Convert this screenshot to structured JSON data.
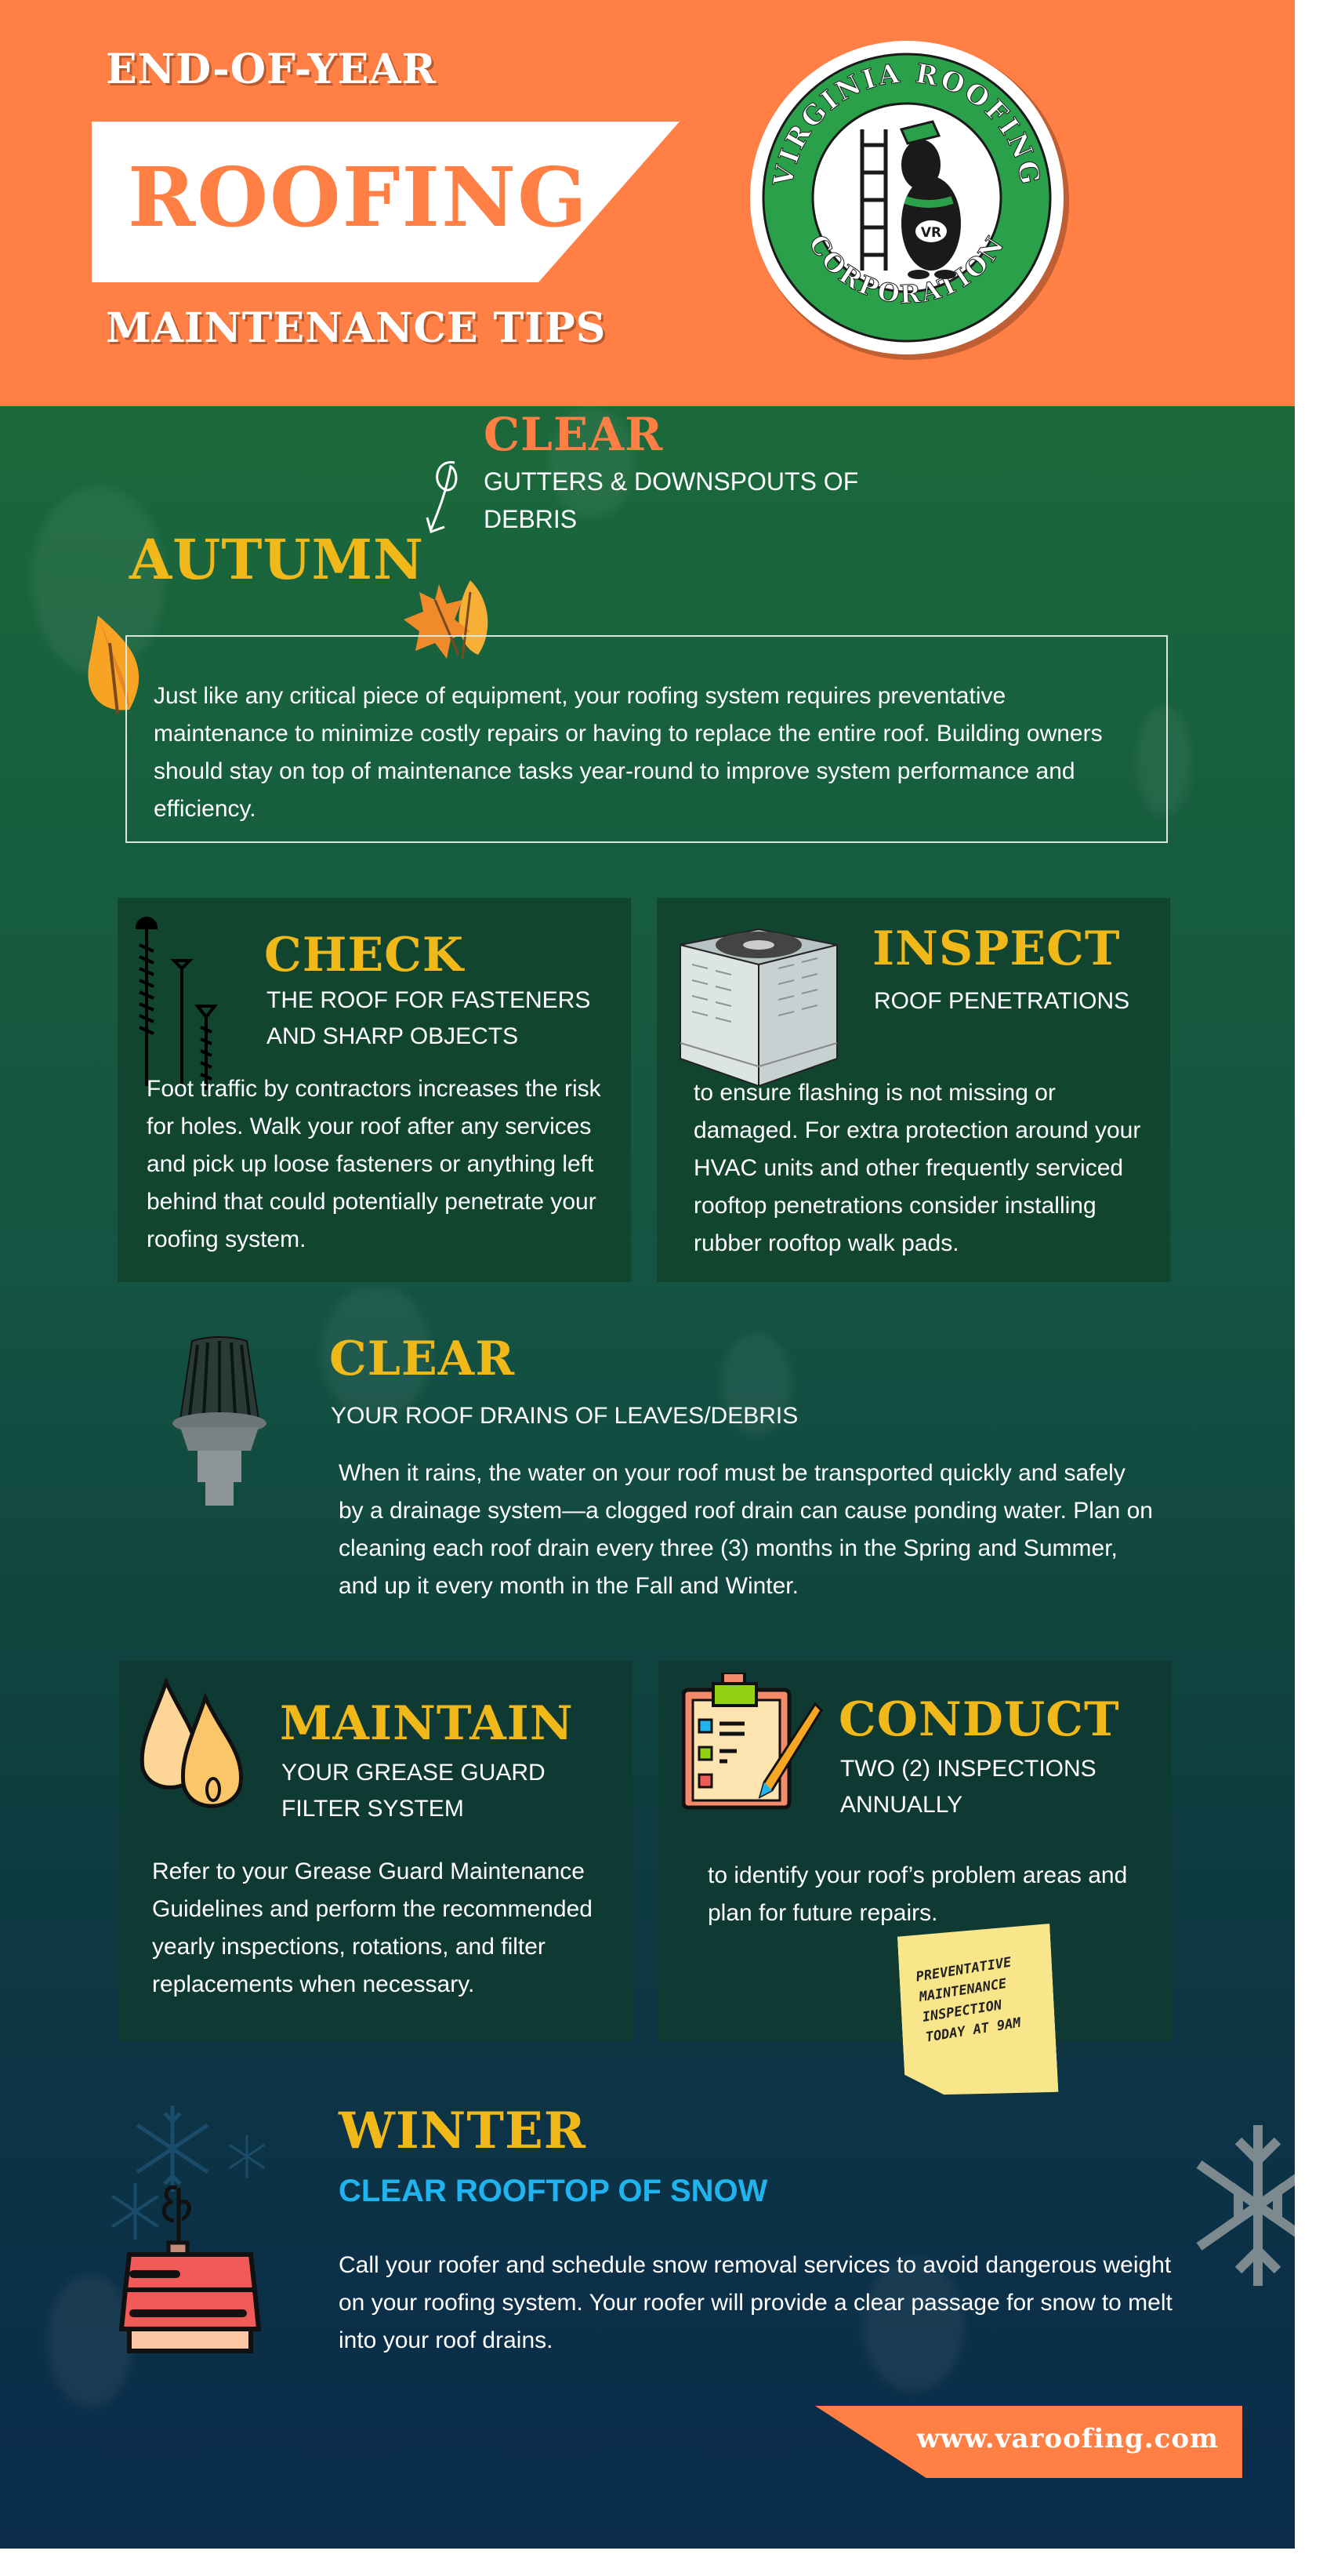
{
  "header": {
    "pre_title": "END-OF-YEAR",
    "title": "ROOFING",
    "subtitle": "MAINTENANCE TIPS",
    "logo": {
      "top_text": "VIRGINIA ROOFING",
      "bottom_text": "CORPORATION",
      "monogram": "VR",
      "ring_color": "#2aa04a"
    }
  },
  "autumn": {
    "clear_heading": "CLEAR",
    "clear_label_line1": "GUTTERS & DOWNSPOUTS OF",
    "clear_label_line2": "DEBRIS",
    "season": "AUTUMN",
    "intro": "Just like any critical piece of equipment, your roofing system requires preventative maintenance to minimize costly repairs or having to replace the entire roof. Building owners should stay on top of maintenance tasks year-round to improve system performance and efficiency."
  },
  "cards": {
    "check": {
      "heading": "CHECK",
      "label_line1": "THE ROOF FOR FASTENERS",
      "label_line2": "AND SHARP OBJECTS",
      "body": "Foot traffic by contractors increases the risk for holes. Walk your roof after any services and pick up loose fasteners or anything left behind that could potentially penetrate your roofing system."
    },
    "inspect": {
      "heading": "INSPECT",
      "label_line1": "ROOF PENETRATIONS",
      "body": "to ensure flashing is not missing or damaged. For extra protection around your HVAC units and other frequently serviced rooftop penetrations consider installing rubber rooftop walk pads."
    },
    "drains": {
      "heading": "CLEAR",
      "label_line1": "YOUR ROOF DRAINS OF LEAVES/DEBRIS",
      "body": "When it rains, the water on your roof must be transported quickly and safely by a drainage system—a clogged roof drain can cause ponding water. Plan on cleaning each roof drain every three (3) months in the Spring and Summer, and up it every month in the Fall and Winter."
    },
    "maintain": {
      "heading": "MAINTAIN",
      "label_line1": "YOUR GREASE GUARD",
      "label_line2": "FILTER SYSTEM",
      "body": "Refer to your Grease Guard Maintenance Guidelines and perform the recommended yearly inspections, rotations, and filter replacements when necessary."
    },
    "conduct": {
      "heading": "CONDUCT",
      "label_line1": "TWO (2) INSPECTIONS",
      "label_line2": "ANNUALLY",
      "body": "to identify your roof’s problem areas and plan for future repairs.",
      "sticky_note": [
        "PREVENTATIVE",
        "MAINTENANCE",
        "INSPECTION",
        "TODAY AT 9AM"
      ]
    }
  },
  "winter": {
    "season": "WINTER",
    "label": "CLEAR ROOFTOP OF SNOW",
    "body": "Call your roofer and schedule snow removal services to avoid dangerous weight on your roofing system.  Your roofer will provide a clear passage for snow to melt into your roof drains."
  },
  "footer": {
    "url": "www.varoofing.com"
  },
  "colors": {
    "orange": "#ff7f44",
    "yellow": "#f0b818",
    "blue_label": "#1fb4ef",
    "green_bg": "#1c6b3a",
    "navy_bg": "#0a2b4c"
  }
}
